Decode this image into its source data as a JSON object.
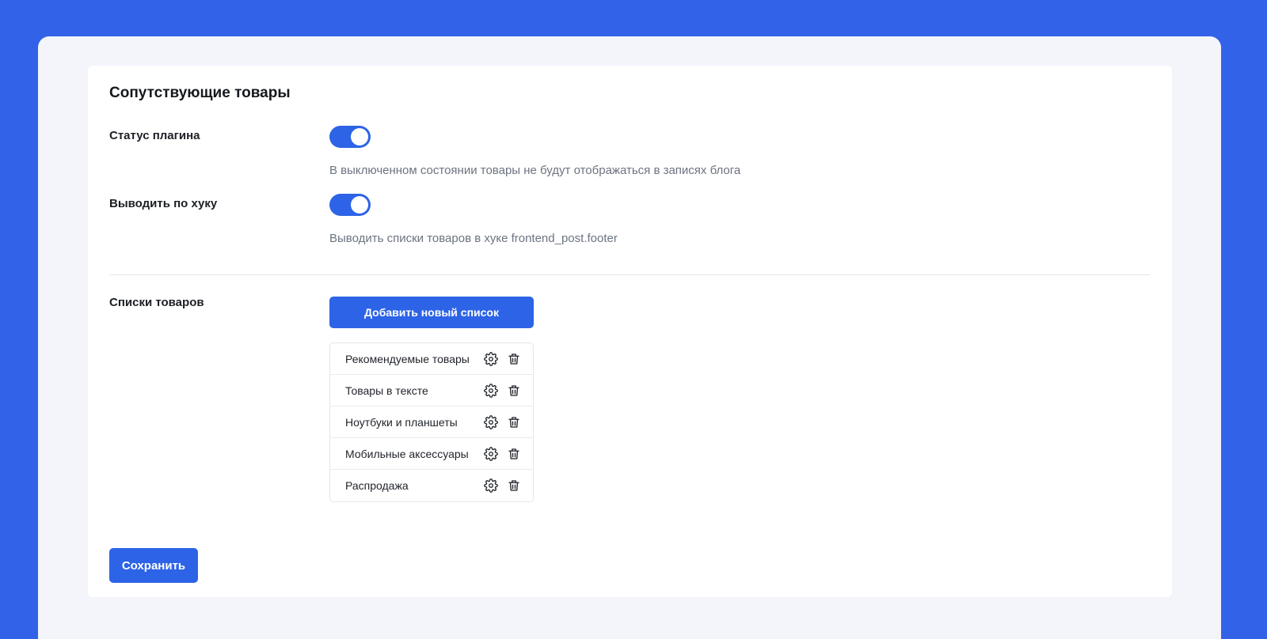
{
  "page": {
    "title": "Сопутствующие товары"
  },
  "settings": {
    "plugin_status": {
      "label": "Статус плагина",
      "enabled": true,
      "hint": "В выключенном состоянии товары не будут отображаться в записях блога"
    },
    "output_hook": {
      "label": "Выводить по хуку",
      "enabled": true,
      "hint": "Выводить списки товаров в хуке frontend_post.footer"
    }
  },
  "product_lists": {
    "label": "Списки товаров",
    "add_button_label": "Добавить новый список",
    "items": [
      {
        "label": "Рекомендуемые товары",
        "settings_icon": "gear-icon",
        "delete_icon": "trash-icon"
      },
      {
        "label": "Товары в тексте",
        "settings_icon": "gear-icon",
        "delete_icon": "trash-icon"
      },
      {
        "label": "Ноутбуки и планшеты",
        "settings_icon": "gear-icon",
        "delete_icon": "trash-icon"
      },
      {
        "label": "Мобильные аксессуары",
        "settings_icon": "gear-icon",
        "delete_icon": "trash-icon"
      },
      {
        "label": "Распродажа",
        "settings_icon": "gear-icon",
        "delete_icon": "trash-icon"
      }
    ]
  },
  "actions": {
    "save_label": "Сохранить"
  },
  "colors": {
    "background": "#3262e8",
    "accent": "#2d63e6",
    "panel": "#f3f5fb",
    "card": "#ffffff"
  }
}
